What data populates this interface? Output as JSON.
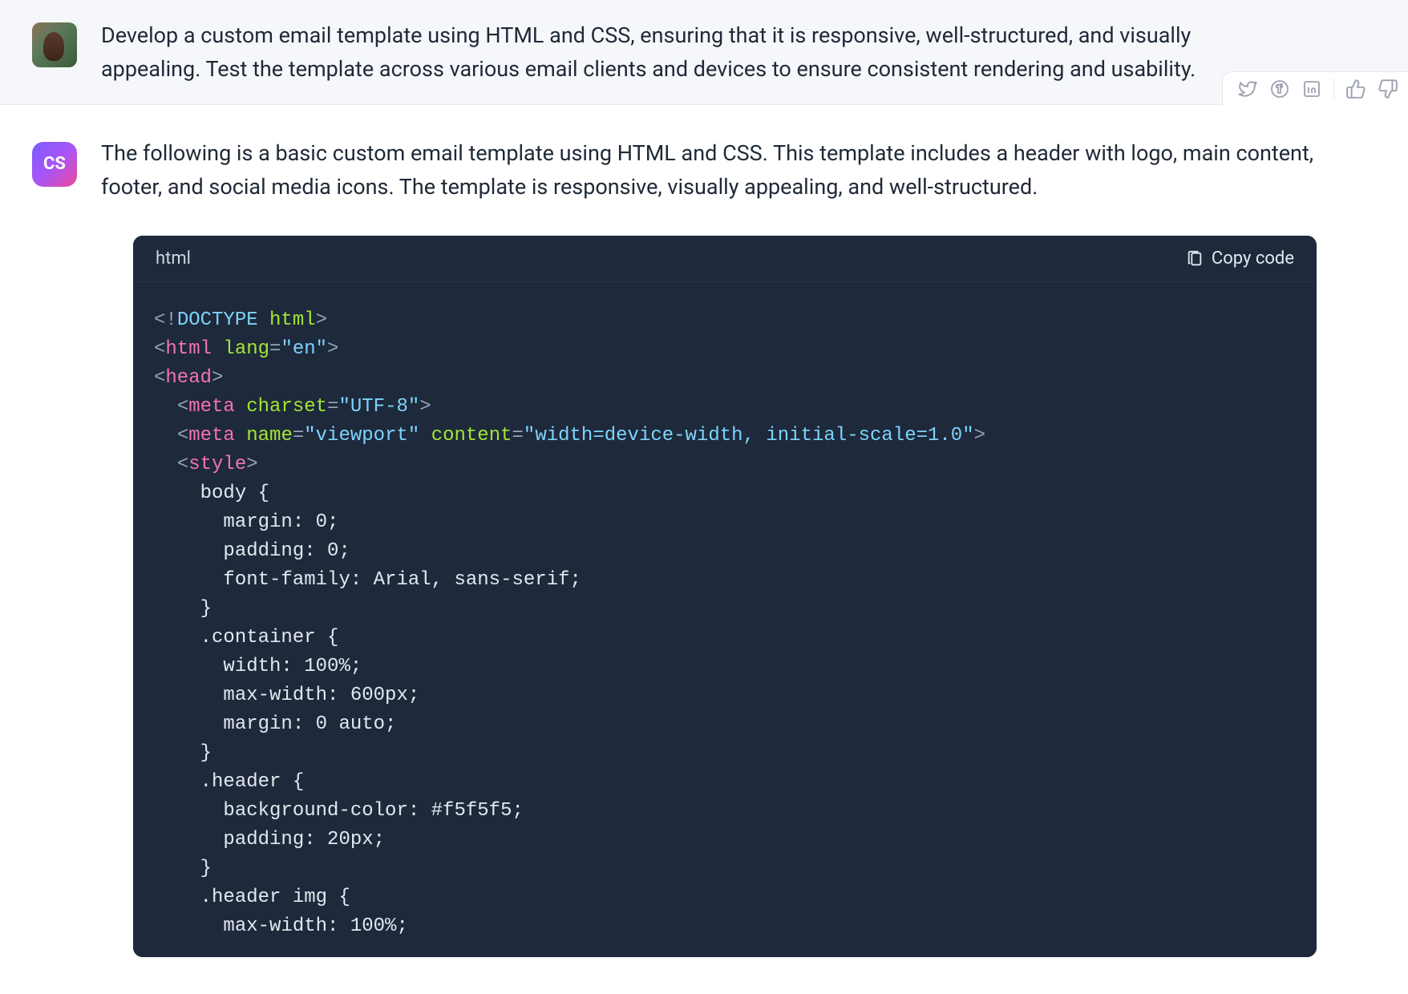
{
  "user_message": "Develop a custom email template using HTML and CSS, ensuring that it is responsive, well-structured, and visually appealing. Test the template across various email clients and devices to ensure consistent rendering and usability.",
  "assistant_avatar_text": "CS",
  "assistant_message": "The following is a basic custom email template using HTML and CSS. This template includes a header with logo, main content, footer, and social media icons. The template is responsive, visually appealing, and well-structured.",
  "code_block": {
    "language": "html",
    "copy_label": "Copy code",
    "lines": [
      [
        {
          "t": "<!",
          "c": "tok-tag-punct"
        },
        {
          "t": "DOCTYPE ",
          "c": "tok-doctype-word"
        },
        {
          "t": "html",
          "c": "tok-html-word"
        },
        {
          "t": ">",
          "c": "tok-tag-punct"
        }
      ],
      [
        {
          "t": "<",
          "c": "tok-tag-punct"
        },
        {
          "t": "html",
          "c": "tok-tag"
        },
        {
          "t": " ",
          "c": "tok-text"
        },
        {
          "t": "lang",
          "c": "tok-attr"
        },
        {
          "t": "=",
          "c": "tok-eq"
        },
        {
          "t": "\"en\"",
          "c": "tok-string"
        },
        {
          "t": ">",
          "c": "tok-tag-punct"
        }
      ],
      [
        {
          "t": "<",
          "c": "tok-tag-punct"
        },
        {
          "t": "head",
          "c": "tok-tag"
        },
        {
          "t": ">",
          "c": "tok-tag-punct"
        }
      ],
      [
        {
          "t": "  ",
          "c": "tok-text"
        },
        {
          "t": "<",
          "c": "tok-tag-punct"
        },
        {
          "t": "meta",
          "c": "tok-tag"
        },
        {
          "t": " ",
          "c": "tok-text"
        },
        {
          "t": "charset",
          "c": "tok-attr"
        },
        {
          "t": "=",
          "c": "tok-eq"
        },
        {
          "t": "\"UTF-8\"",
          "c": "tok-string"
        },
        {
          "t": ">",
          "c": "tok-tag-punct"
        }
      ],
      [
        {
          "t": "  ",
          "c": "tok-text"
        },
        {
          "t": "<",
          "c": "tok-tag-punct"
        },
        {
          "t": "meta",
          "c": "tok-tag"
        },
        {
          "t": " ",
          "c": "tok-text"
        },
        {
          "t": "name",
          "c": "tok-attr"
        },
        {
          "t": "=",
          "c": "tok-eq"
        },
        {
          "t": "\"viewport\"",
          "c": "tok-string"
        },
        {
          "t": " ",
          "c": "tok-text"
        },
        {
          "t": "content",
          "c": "tok-attr"
        },
        {
          "t": "=",
          "c": "tok-eq"
        },
        {
          "t": "\"width=device-width, initial-scale=1.0\"",
          "c": "tok-string"
        },
        {
          "t": ">",
          "c": "tok-tag-punct"
        }
      ],
      [
        {
          "t": "  ",
          "c": "tok-text"
        },
        {
          "t": "<",
          "c": "tok-tag-punct"
        },
        {
          "t": "style",
          "c": "tok-tag"
        },
        {
          "t": ">",
          "c": "tok-tag-punct"
        }
      ],
      [
        {
          "t": "    body {",
          "c": "tok-text"
        }
      ],
      [
        {
          "t": "      margin: 0;",
          "c": "tok-text"
        }
      ],
      [
        {
          "t": "      padding: 0;",
          "c": "tok-text"
        }
      ],
      [
        {
          "t": "      font-family: Arial, sans-serif;",
          "c": "tok-text"
        }
      ],
      [
        {
          "t": "    }",
          "c": "tok-text"
        }
      ],
      [
        {
          "t": "    .container {",
          "c": "tok-text"
        }
      ],
      [
        {
          "t": "      width: 100%;",
          "c": "tok-text"
        }
      ],
      [
        {
          "t": "      max-width: 600px;",
          "c": "tok-text"
        }
      ],
      [
        {
          "t": "      margin: 0 auto;",
          "c": "tok-text"
        }
      ],
      [
        {
          "t": "    }",
          "c": "tok-text"
        }
      ],
      [
        {
          "t": "    .header {",
          "c": "tok-text"
        }
      ],
      [
        {
          "t": "      background-color: #f5f5f5;",
          "c": "tok-text"
        }
      ],
      [
        {
          "t": "      padding: 20px;",
          "c": "tok-text"
        }
      ],
      [
        {
          "t": "    }",
          "c": "tok-text"
        }
      ],
      [
        {
          "t": "    .header img {",
          "c": "tok-text"
        }
      ],
      [
        {
          "t": "      max-width: 100%;",
          "c": "tok-text"
        }
      ]
    ]
  },
  "icons": {
    "twitter": "twitter-icon",
    "facebook": "facebook-icon",
    "linkedin": "linkedin-icon",
    "thumbs_up": "thumbs-up-icon",
    "thumbs_down": "thumbs-down-icon",
    "clipboard": "clipboard-icon"
  }
}
